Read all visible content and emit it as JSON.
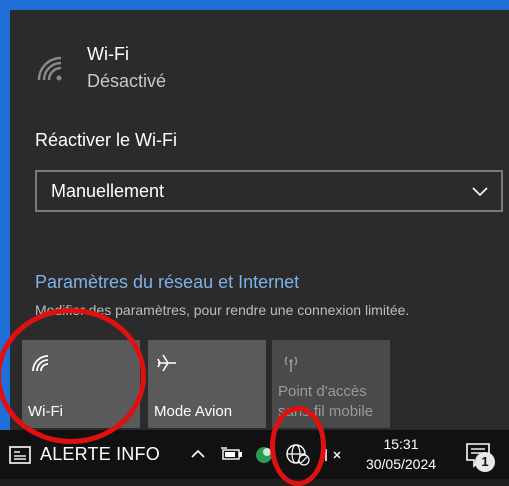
{
  "wifi": {
    "name": "Wi-Fi",
    "state": "Désactivé"
  },
  "reactivate": {
    "label": "Réactiver le Wi-Fi",
    "selected": "Manuellement"
  },
  "network_settings": {
    "link": "Paramètres du réseau et Internet",
    "description": "Modifier des paramètres, pour rendre une connexion limitée."
  },
  "tiles": [
    {
      "label": "Wi-Fi",
      "icon": "wifi-icon"
    },
    {
      "label": "Mode Avion",
      "icon": "airplane-icon"
    },
    {
      "label": "Point d'accès sans fil mobile",
      "icon": "hotspot-icon",
      "disabled": true
    }
  ],
  "taskbar": {
    "news": "ALERTE INFO",
    "time": "15:31",
    "date": "30/05/2024",
    "notifications": "1"
  },
  "colors": {
    "link": "#7fb2e6",
    "annotation": "#e01010",
    "tile": "#5a5a5a"
  }
}
